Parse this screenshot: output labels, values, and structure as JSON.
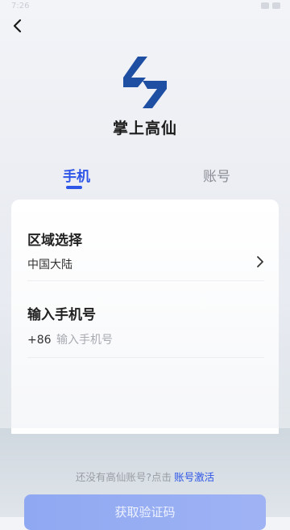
{
  "status": {
    "time": "7:26"
  },
  "app": {
    "name": "掌上高仙"
  },
  "tabs": {
    "phone": "手机",
    "account": "账号"
  },
  "region": {
    "title": "区域选择",
    "value": "中国大陆"
  },
  "phone": {
    "title": "输入手机号",
    "country_code": "+86",
    "placeholder": "输入手机号"
  },
  "footer": {
    "signup_text": "还没有高仙账号?点击",
    "activate_link": "账号激活",
    "submit_label": "获取验证码"
  },
  "colors": {
    "accent": "#2d55e8",
    "logo": "#1f4fa3"
  },
  "icons": [
    "back-arrow-icon",
    "gausium-logo-icon",
    "chevron-right-icon"
  ]
}
